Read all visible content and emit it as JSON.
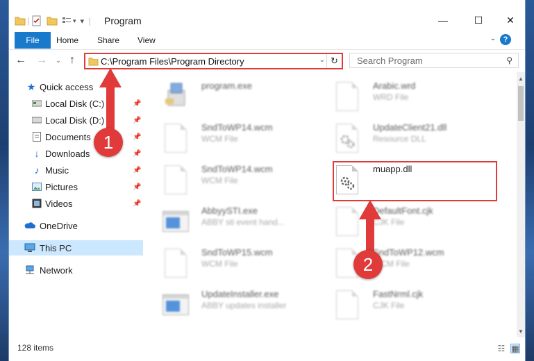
{
  "window": {
    "title": "Program",
    "controls": {
      "minimize": "—",
      "maximize": "☐",
      "close": "✕"
    }
  },
  "ribbon": {
    "tabs": [
      "File",
      "Home",
      "Share",
      "View"
    ],
    "help": "?"
  },
  "navigation": {
    "address": "C:\\Program Files\\Program Directory",
    "search_placeholder": "Search Program"
  },
  "sidebar": {
    "items": [
      {
        "label": "Quick access",
        "icon": "star-icon",
        "pinned": false
      },
      {
        "label": "Local Disk (C:)",
        "icon": "drive-icon",
        "pinned": true
      },
      {
        "label": "Local Disk (D:)",
        "icon": "drive-icon",
        "pinned": true
      },
      {
        "label": "Documents",
        "icon": "documents-icon",
        "pinned": true
      },
      {
        "label": "Downloads",
        "icon": "download-icon",
        "pinned": true
      },
      {
        "label": "Music",
        "icon": "music-icon",
        "pinned": true
      },
      {
        "label": "Pictures",
        "icon": "pictures-icon",
        "pinned": true
      },
      {
        "label": "Videos",
        "icon": "videos-icon",
        "pinned": true
      },
      {
        "label": "OneDrive",
        "icon": "cloud-icon",
        "pinned": false
      },
      {
        "label": "This PC",
        "icon": "computer-icon",
        "pinned": false,
        "selected": true
      },
      {
        "label": "Network",
        "icon": "network-icon",
        "pinned": false
      }
    ]
  },
  "files": [
    {
      "name": "program.exe",
      "type": "",
      "icon": "installer-icon",
      "blurred": true
    },
    {
      "name": "Arabic.wrd",
      "type": "WRD File",
      "icon": "document-icon",
      "blurred": true
    },
    {
      "name": "SndToWP14.wcm",
      "type": "WCM File",
      "icon": "document-icon",
      "blurred": true
    },
    {
      "name": "UpdateClient21.dll",
      "type": "Resource DLL",
      "icon": "dll-icon",
      "blurred": true
    },
    {
      "name": "SndToWP14.wcm",
      "type": "WCM File",
      "icon": "document-icon",
      "blurred": true
    },
    {
      "name": "muapp.dll",
      "type": "",
      "icon": "dll-icon",
      "blurred": false
    },
    {
      "name": "AbbyySTI.exe",
      "type": "ABBY sti event hand...",
      "icon": "exe-icon",
      "blurred": true
    },
    {
      "name": "DefaultFont.cjk",
      "type": "CJK File",
      "icon": "document-icon",
      "blurred": true
    },
    {
      "name": "SndToWP15.wcm",
      "type": "WCM File",
      "icon": "document-icon",
      "blurred": true
    },
    {
      "name": "SndToWP12.wcm",
      "type": "WCM File",
      "icon": "document-icon",
      "blurred": true
    },
    {
      "name": "UpdateInstaller.exe",
      "type": "ABBY updates installer",
      "icon": "exe-icon",
      "blurred": true
    },
    {
      "name": "FastNrml.cjk",
      "type": "CJK File",
      "icon": "document-icon",
      "blurred": true
    }
  ],
  "status": {
    "items_count": "128 items"
  },
  "annotations": {
    "step1": "1",
    "step2": "2",
    "color": "#e03a3a"
  }
}
